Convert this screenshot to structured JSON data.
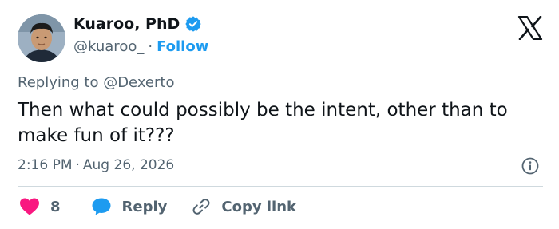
{
  "author": {
    "name": "Kuaroo, PhD",
    "handle": "@kuaroo_",
    "separator": "·",
    "follow_label": "Follow"
  },
  "reply_context": "Replying to @Dexerto",
  "tweet": {
    "text": "Then what could possibly be the intent, other than to make fun of it???",
    "time": "2:16 PM",
    "separator": "·",
    "date": "Aug 26, 2026"
  },
  "actions": {
    "like_count": "8",
    "reply_label": "Reply",
    "copy_link_label": "Copy link"
  },
  "icons": {
    "verified": "verified-badge-icon",
    "logo": "x-logo-icon",
    "info": "info-icon",
    "like": "heart-icon",
    "reply": "speech-bubble-icon",
    "copy": "link-icon"
  },
  "colors": {
    "accent": "#1d9bf0",
    "like": "#f91880",
    "text": "#0f1419",
    "muted": "#536471"
  }
}
